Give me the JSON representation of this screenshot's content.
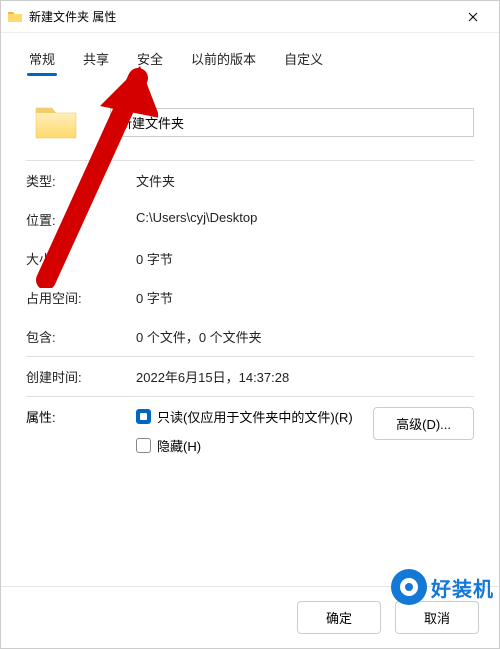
{
  "titlebar": {
    "title": "新建文件夹 属性"
  },
  "tabs": [
    {
      "label": "常规"
    },
    {
      "label": "共享"
    },
    {
      "label": "安全"
    },
    {
      "label": "以前的版本"
    },
    {
      "label": "自定义"
    }
  ],
  "folder_name": "新建文件夹",
  "fields": {
    "type_label": "类型:",
    "type_value": "文件夹",
    "location_label": "位置:",
    "location_value": "C:\\Users\\cyj\\Desktop",
    "size_label": "大小:",
    "size_value": "0 字节",
    "size_on_disk_label": "占用空间:",
    "size_on_disk_value": "0 字节",
    "contains_label": "包含:",
    "contains_value": "0 个文件，0 个文件夹",
    "created_label": "创建时间:",
    "created_value": "2022年6月15日，14:37:28",
    "attrs_label": "属性:",
    "readonly_label": "只读(仅应用于文件夹中的文件)(R)",
    "hidden_label": "隐藏(H)",
    "advanced_button": "高级(D)..."
  },
  "footer": {
    "ok": "确定",
    "cancel": "取消"
  },
  "watermark": "好装机"
}
